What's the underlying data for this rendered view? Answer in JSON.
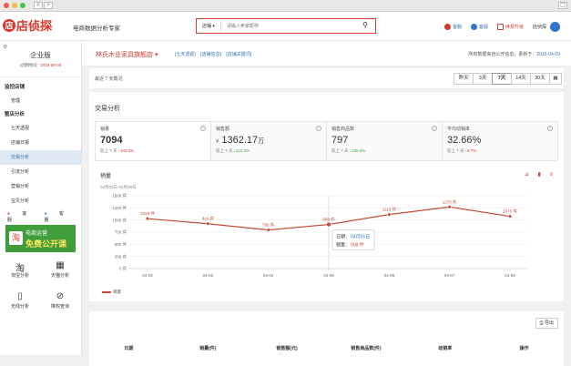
{
  "browser": {
    "back": "<",
    "forward": ">",
    "window_button": "▢"
  },
  "top": {
    "logo_glyph": "店",
    "logo_text": "店侦探",
    "logo_sub": "DIANZHENTAN.COM",
    "slogan": "电商数据分析专家",
    "search_category": "店铺 ▾",
    "search_placeholder": "请输入卖家昵称",
    "links": [
      "客服",
      "客服",
      "续费升级",
      "店侦探"
    ]
  },
  "sidebar": {
    "settings_glyph": "⚙",
    "edition": "企业版",
    "expire_label": "过期时间：",
    "expire_date": "2018-08-08",
    "groups": [
      {
        "title": "监控店铺",
        "items": [
          "管理"
        ]
      },
      {
        "title": "整店分析",
        "items": [
          "七天透视",
          "店铺日报",
          "交易分析",
          "引流分析",
          "营销分析",
          "宝贝分析"
        ]
      }
    ],
    "active_item": "交易分析",
    "service": [
      "客服",
      "客服"
    ],
    "banner": {
      "icon": "淘",
      "line1": "电商运营",
      "line2": "免费公开课"
    },
    "tools": [
      {
        "label": "淘宝分析",
        "icon": "淘"
      },
      {
        "label": "天猫分析",
        "icon": "▦"
      },
      {
        "label": "无线分析",
        "icon": "▯"
      },
      {
        "label": "降权查询",
        "icon": "⊘"
      }
    ]
  },
  "shop": {
    "name": "林氏木业家具旗舰店 ▾",
    "links": [
      "[七天透视]",
      "[店铺信息]",
      "[店铺关键词]"
    ],
    "update_label": "所有数据来自公开信息，更新于：",
    "update_date": "2015-04-09"
  },
  "range": {
    "label": "最近 7 天概况",
    "buttons": [
      "昨天",
      "3天",
      "7天",
      "14天",
      "30天",
      "▦"
    ],
    "active": "7天"
  },
  "section_title": "交易分析",
  "kpis": [
    {
      "name": "销量",
      "value": "7094",
      "unit": "",
      "currency": "",
      "cmp_label": "较上 7 天",
      "cmp_value": "↑103.0%",
      "dir": "up"
    },
    {
      "name": "销售额",
      "value": "1362.17",
      "unit": "万",
      "currency": "¥",
      "cmp_label": "较上 7 天",
      "cmp_value": "↓112.2%",
      "dir": "down"
    },
    {
      "name": "销售商品数",
      "value": "797",
      "unit": "",
      "currency": "",
      "cmp_label": "较上 7 天",
      "cmp_value": "↓180.0%",
      "dir": "down"
    },
    {
      "name": "平均动销率",
      "value": "32.66%",
      "unit": "",
      "currency": "",
      "cmp_label": "较上 7 天",
      "cmp_value": "↑0.7%",
      "dir": "up"
    }
  ],
  "chart_data": {
    "type": "line",
    "title": "销量",
    "date_range": "04月02日-04月08日",
    "categories": [
      "04-02",
      "04-03",
      "04-04",
      "04-05",
      "04-06",
      "04-07",
      "04-08"
    ],
    "series": [
      {
        "name": "销量",
        "values": [
          1028,
          924,
          795,
          908,
          1113,
          1270,
          1075
        ],
        "color": "#c44b36"
      }
    ],
    "data_labels": [
      "1028 件",
      "924 件",
      "795 件",
      "908 件",
      "1113 件",
      "1270 件",
      "1075 件"
    ],
    "yticks": [
      "0 件",
      "250 件",
      "500 件",
      "750 件",
      "1000 件",
      "1250 件",
      "1500 件"
    ],
    "ylim": [
      0,
      1500
    ],
    "tooltip": {
      "date_label": "日期：",
      "date": "04月05日",
      "value_label": "销量：",
      "value": "908 件"
    },
    "tools": "⊿ ▮ ≡"
  },
  "table": {
    "export": "⎙ 导出",
    "headers": [
      "日期",
      "销量(件)",
      "销售额(元)",
      "销售商品数(件)",
      "动销率",
      "操作"
    ]
  }
}
